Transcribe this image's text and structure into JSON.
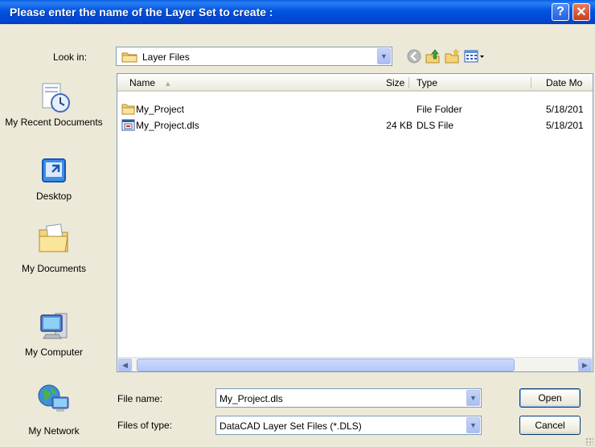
{
  "titlebar": {
    "title": "Please enter the name of the Layer Set to create :",
    "help_label": "?",
    "close_label": "✕"
  },
  "lookin": {
    "label": "Look in:",
    "value": "Layer Files"
  },
  "places": [
    {
      "label": "My Recent Documents",
      "icon": "recent-documents-icon"
    },
    {
      "label": "Desktop",
      "icon": "desktop-icon"
    },
    {
      "label": "My Documents",
      "icon": "my-documents-icon"
    },
    {
      "label": "My Computer",
      "icon": "my-computer-icon"
    },
    {
      "label": "My Network",
      "icon": "network-icon"
    }
  ],
  "columns": {
    "name": "Name",
    "size": "Size",
    "type": "Type",
    "date": "Date Mo"
  },
  "files": [
    {
      "name": "My_Project",
      "size": "",
      "type": "File Folder",
      "date": "5/18/201",
      "icon": "folder-icon"
    },
    {
      "name": "My_Project.dls",
      "size": "24 KB",
      "type": "DLS File",
      "date": "5/18/201",
      "icon": "dls-file-icon"
    }
  ],
  "filename": {
    "label": "File name:",
    "value": "My_Project.dls"
  },
  "filetype": {
    "label": "Files of type:",
    "value": "DataCAD Layer Set Files (*.DLS)"
  },
  "buttons": {
    "open": "Open",
    "cancel": "Cancel"
  },
  "colors": {
    "titlebar": "#0053e0",
    "dialog_bg": "#ece9d8",
    "field_border": "#7f9db9"
  }
}
